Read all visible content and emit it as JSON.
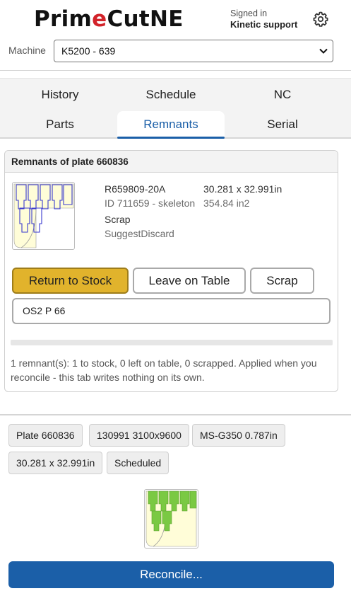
{
  "header": {
    "logo_prefix": "Prim",
    "logo_accent": "e",
    "logo_suffix": "CutNE",
    "signed_in_label": "Signed in",
    "user_name": "Kinetic support",
    "settings_icon": "gear-icon"
  },
  "machine": {
    "label": "Machine",
    "selected": "K5200 - 639"
  },
  "tabs": [
    {
      "label": "History",
      "active": false
    },
    {
      "label": "Schedule",
      "active": false
    },
    {
      "label": "NC",
      "active": false
    },
    {
      "label": "Parts",
      "active": false
    },
    {
      "label": "Remnants",
      "active": true
    },
    {
      "label": "Serial",
      "active": false
    }
  ],
  "remnants_card": {
    "title": "Remnants of plate 660836",
    "remnant": {
      "part_number": "R659809-20A",
      "size": "30.281 x 32.991in",
      "id_text": "ID 711659 - skeleton",
      "area": "354.84 in2",
      "status": "Scrap",
      "suggestion": "SuggestDiscard"
    },
    "buttons": {
      "return_to_stock": "Return to Stock",
      "leave_on_table": "Leave on Table",
      "scrap": "Scrap"
    },
    "location_value": "OS2 P 66",
    "progress_fraction": 0,
    "summary": "1 remnant(s): 1 to stock, 0 left on table, 0 scrapped. Applied when you reconcile - this tab writes nothing on its own."
  },
  "plate_info": {
    "chips": [
      "Plate 660836",
      "130991 3100x9600",
      "MS-G350 0.787in",
      "30.281 x 32.991in",
      "Scheduled"
    ]
  },
  "reconcile_button": "Reconcile...",
  "colors": {
    "accent_blue": "#1b5fa8",
    "return_gold": "#e1b32c",
    "logo_red": "#d2232a",
    "parts_green": "#7ac943"
  }
}
